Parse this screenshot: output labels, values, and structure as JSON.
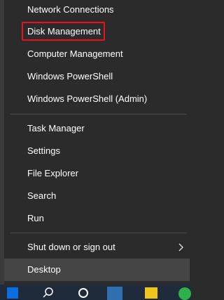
{
  "menu": {
    "network_connections": "Network Connections",
    "disk_management": "Disk Management",
    "computer_management": "Computer Management",
    "windows_powershell": "Windows PowerShell",
    "windows_powershell_admin": "Windows PowerShell (Admin)",
    "task_manager": "Task Manager",
    "settings": "Settings",
    "file_explorer": "File Explorer",
    "search": "Search",
    "run": "Run",
    "shut_down_or_sign_out": "Shut down or sign out",
    "desktop": "Desktop"
  },
  "icons": {
    "chevron": "chevron-right-icon",
    "start": "windows-start-icon",
    "search": "search-icon",
    "task_view": "task-view-icon"
  },
  "colors": {
    "highlight_border": "#e81123",
    "menu_background": "#2b2b2b",
    "hover_background": "#454545"
  }
}
